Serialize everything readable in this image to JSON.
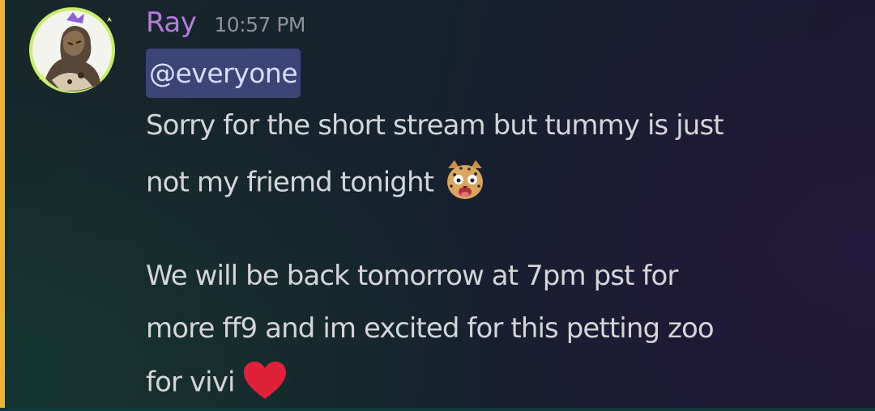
{
  "message": {
    "author": "Ray",
    "timestamp": "10:57 PM",
    "mention": "@everyone",
    "lines": [
      "Sorry for the short stream but tummy is just",
      "not my friemd tonight",
      "We will be back tomorrow at 7pm pst for",
      "more ff9 and im excited for this petting zoo",
      "for vivi"
    ],
    "emojis": [
      "cheetah-face-emoji",
      "red-heart-emoji"
    ]
  },
  "colors": {
    "username": "#b57cdc",
    "timestamp": "#8d9096",
    "mention_bg": "#3b4676",
    "mention_bar": "#f0b232",
    "text": "#d3d5d9"
  }
}
